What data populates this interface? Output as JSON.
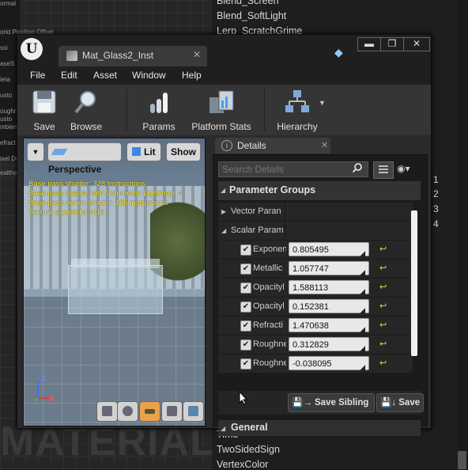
{
  "background_editor": {
    "node_lines": [
      "ormal",
      "orld Position Offset",
      "ssi",
      "aseS",
      "ieta",
      "usto",
      "oughn",
      "usto",
      "mbient",
      "efract",
      "ixel Dep",
      "ealtha"
    ],
    "watermark": "MATERIAL",
    "palette_items": [
      "Blend_Screen",
      "Blend_SoftLight",
      "Lerp_ScratchGrime",
      "Time",
      "TwoSidedSign",
      "VertexColor"
    ],
    "side_numbers": [
      "1",
      "2",
      "3",
      "4"
    ]
  },
  "window": {
    "logo": "U",
    "tab_title": "Mat_Glass2_Inst",
    "tab_close": "✕",
    "controls": {
      "minimize": "▬",
      "maximize": "❐",
      "close": "✕"
    },
    "menu": [
      "File",
      "Edit",
      "Asset",
      "Window",
      "Help"
    ],
    "toolbar": {
      "save": "Save",
      "browse": "Browse",
      "params": "Params",
      "platform_stats": "Platform Stats",
      "hierarchy": "Hierarchy"
    }
  },
  "viewport": {
    "view_mode_label": "Perspective",
    "lit_label": "Lit",
    "show_label": "Show",
    "stats": [
      "Base pass shader: 328 instructions",
      "Base pass shader with Volumetric Lightmap: 4",
      "Base pass vertex shader: 165 instructions",
      "Texture samplers: 4/16"
    ],
    "axes": {
      "z": "Z",
      "x": "X"
    },
    "active_shape_index": 2
  },
  "details": {
    "tab_label": "Details",
    "tab_close": "✕",
    "search_placeholder": "Search Details",
    "eye_icon": "◉▾",
    "section_title": "Parameter Groups",
    "vector_group": "Vector Paran",
    "scalar_group": "Scalar Param",
    "params": [
      {
        "name": "Exponen",
        "value": "0.805495",
        "checked": true
      },
      {
        "name": "Metallic",
        "value": "1.057747",
        "checked": true
      },
      {
        "name": "Opacityl",
        "value": "1.588113",
        "checked": true
      },
      {
        "name": "Opacityl",
        "value": "0.152381",
        "checked": true
      },
      {
        "name": "Refracti",
        "value": "1.470638",
        "checked": true
      },
      {
        "name": "Roughne",
        "value": "0.312829",
        "checked": true
      },
      {
        "name": "Roughne",
        "value": "-0.038095",
        "checked": true
      }
    ],
    "save_sibling": "Save Sibling",
    "save_child": "Save",
    "general_title": "General",
    "colors": {
      "reset_arrow": "#e8d43a",
      "stats_text": "#ffef3a",
      "active_shape": "#e8a24a"
    }
  }
}
